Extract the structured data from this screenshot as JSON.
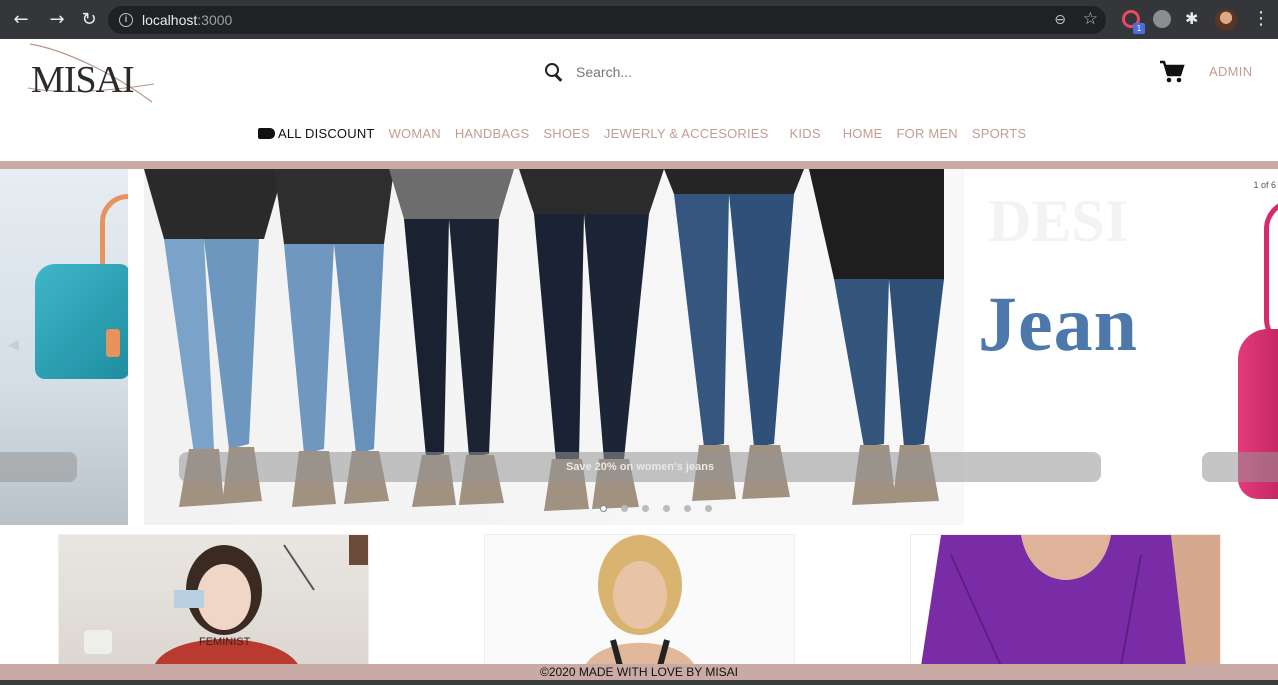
{
  "browser": {
    "url_host": "localhost",
    "url_port": ":3000",
    "extension_badge": "1"
  },
  "header": {
    "logo_text": "MISAI",
    "search_placeholder": "Search...",
    "admin_label": "ADMIN"
  },
  "nav": {
    "items": [
      {
        "label": "ALL DISCOUNT"
      },
      {
        "label": "WOMAN"
      },
      {
        "label": "HANDBAGS"
      },
      {
        "label": "SHOES"
      },
      {
        "label": "JEWERLY & ACCESORIES"
      },
      {
        "label": "KIDS"
      },
      {
        "label": "HOME"
      },
      {
        "label": "FOR MEN"
      },
      {
        "label": "SPORTS"
      }
    ]
  },
  "carousel": {
    "caption": "Save 20% on women's jeans",
    "counter": "1 of 6",
    "headline": "Jean",
    "slide_count": 6,
    "active_index": 0
  },
  "footer": {
    "text": "©2020 MADE WITH LOVE BY MISAI"
  },
  "colors": {
    "accent": "#c39d92",
    "bar": "#c9aaa4",
    "headline": "#4c78ab"
  }
}
